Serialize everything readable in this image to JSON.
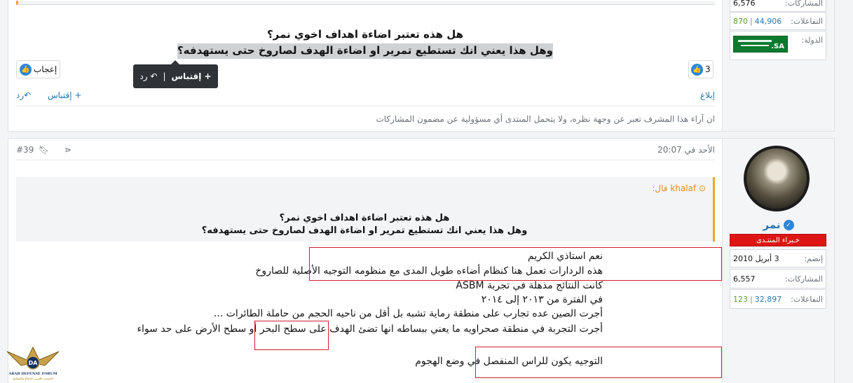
{
  "post1": {
    "stats": {
      "posts_label": "المشاركات:",
      "posts_value": "6,576",
      "reactions_label": "التفاعلات:",
      "reactions_value": "44,906",
      "reactions_score": "870",
      "country_label": "الدولة:",
      "flag_text": "SA."
    },
    "line1": "هل هذه تعتبر اضاءة اهداف اخوي نمر؟",
    "line2": "وهل هذا يعني انك تستطيع تمرير او اضاءة الهدف لصاروخ حتى يستهدفه؟",
    "like_label": "إعجاب",
    "reaction_count": "3",
    "tooltip_quote": "+ إقتباس",
    "tooltip_sep": "|",
    "tooltip_reply": "رد",
    "report": "إبلاغ",
    "multiquote": "+ إقتباس",
    "reply": "رد",
    "disclaimer": "ان آراء هذا المشرف تعبر عن وجهة نظره، ولا يتحمل المنتدى أي مسؤولية عن مضمون المشاركات"
  },
  "post2": {
    "date": "الأحد في 20:07",
    "number": "#39",
    "user": {
      "name": "نمر",
      "rank": "خـبراء المنتـدى",
      "joined_label": "إنضم:",
      "joined_value": "3 أبريل 2010",
      "posts_label": "المشاركات:",
      "posts_value": "6,557",
      "reactions_label": "التفاعلات:",
      "reactions_value": "32,897",
      "reactions_score": "123"
    },
    "quote": {
      "author": "khalaf قال:",
      "line1": "هل هذه تعتبر اضاءة اهداف اخوي نمر؟",
      "line2": "وهل هذا يعني انك تستطيع تمرير او اضاءة الهدف لصاروخ حتى يستهدفه؟"
    },
    "body": {
      "l1": "نعم استاذي الكريم",
      "l2": "هذه الردارات تعمل هنا كنظام أضاءه طويل المدى مع منظومه التوجيه الأصلية للصاروخ",
      "l3": "كانت النتائج مذهلة في تجربة ASBM",
      "l4": "في الفترة من ٢٠١٣ إلى ٢٠١٤",
      "l5": "أجرت الصين عده تجارب على منطقة رماية تشبه بل أقل من ناحيه الحجم من حاملة الطائرات ...",
      "l6": "أجرت التجربة في منطقة صحراويه ما يعني ببساطه انها تضئ الهدف على سطح البحر أو سطح الأرض على حد سواء",
      "l7": "التوجيه يكون للراس المنفصل في وضع الهجوم"
    }
  },
  "logo": {
    "title": "ARAB DEFENSE FORUM",
    "subtitle": "المنتدى العربي للدفاع والتسليح",
    "mark": "DA"
  },
  "colors": {
    "accent": "#2577b1",
    "rank_red": "#dd1515",
    "quote_orange": "#f0a234",
    "highlight_box": "#d21f2b"
  }
}
